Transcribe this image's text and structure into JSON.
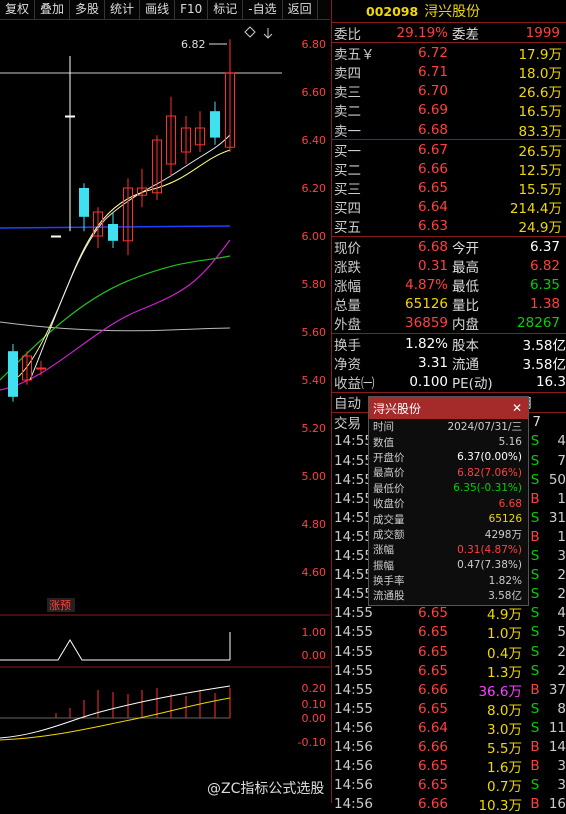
{
  "toolbar": [
    "复权",
    "叠加",
    "多股",
    "统计",
    "画线",
    "F10",
    "标记",
    "-自选",
    "返回"
  ],
  "stock": {
    "code": "002098",
    "name": "浔兴股份"
  },
  "chart": {
    "price_axis": [
      "6.80",
      "6.60",
      "6.40",
      "6.20",
      "6.00",
      "5.80",
      "5.60",
      "5.40",
      "5.20",
      "5.00",
      "4.80",
      "4.60"
    ],
    "high_marker": "6.82",
    "signal_label": "涨预",
    "ind1_axis": [
      "1.00",
      "0.00"
    ],
    "ind2_axis": [
      "0.20",
      "0.10",
      "0.00",
      "-0.10"
    ],
    "up_color": "#ff3030",
    "down_color": "#40e0f0"
  },
  "chart_data": {
    "type": "candlestick",
    "candles": [
      {
        "o": 5.33,
        "c": 5.52,
        "h": 5.55,
        "l": 5.31,
        "dir": "down"
      },
      {
        "o": 5.4,
        "c": 5.5,
        "h": 5.52,
        "l": 5.38,
        "dir": "up"
      },
      {
        "o": 5.45,
        "c": 5.45,
        "h": 5.48,
        "l": 5.42,
        "dir": "up"
      },
      {
        "o": 6.0,
        "c": 6.0,
        "h": 6.0,
        "l": 6.0,
        "dir": "flat"
      },
      {
        "o": 6.5,
        "c": 6.5,
        "h": 6.75,
        "l": 6.02,
        "dir": "flat"
      },
      {
        "o": 6.2,
        "c": 6.08,
        "h": 6.22,
        "l": 6.02,
        "dir": "down"
      },
      {
        "o": 6.0,
        "c": 6.1,
        "h": 6.12,
        "l": 5.95,
        "dir": "up"
      },
      {
        "o": 6.05,
        "c": 5.98,
        "h": 6.1,
        "l": 5.95,
        "dir": "down"
      },
      {
        "o": 5.98,
        "c": 6.2,
        "h": 6.24,
        "l": 5.92,
        "dir": "up"
      },
      {
        "o": 6.17,
        "c": 6.2,
        "h": 6.28,
        "l": 6.12,
        "dir": "up"
      },
      {
        "o": 6.18,
        "c": 6.4,
        "h": 6.42,
        "l": 6.15,
        "dir": "up"
      },
      {
        "o": 6.3,
        "c": 6.5,
        "h": 6.58,
        "l": 6.25,
        "dir": "up"
      },
      {
        "o": 6.35,
        "c": 6.45,
        "h": 6.5,
        "l": 6.3,
        "dir": "up"
      },
      {
        "o": 6.38,
        "c": 6.45,
        "h": 6.52,
        "l": 6.35,
        "dir": "up"
      },
      {
        "o": 6.52,
        "c": 6.41,
        "h": 6.56,
        "l": 6.38,
        "dir": "down"
      },
      {
        "o": 6.37,
        "c": 6.68,
        "h": 6.82,
        "l": 6.35,
        "dir": "up"
      }
    ]
  },
  "quote": {
    "weibi": {
      "label": "委比",
      "value": "29.19%",
      "label2": "委差",
      "value2": "1999"
    },
    "asks": [
      {
        "label": "卖五￥",
        "price": "6.72",
        "vol": "17.9万"
      },
      {
        "label": "卖四",
        "price": "6.71",
        "vol": "18.0万"
      },
      {
        "label": "卖三",
        "price": "6.70",
        "vol": "26.6万"
      },
      {
        "label": "卖二",
        "price": "6.69",
        "vol": "16.5万"
      },
      {
        "label": "卖一",
        "price": "6.68",
        "vol": "83.3万"
      }
    ],
    "bids": [
      {
        "label": "买一",
        "price": "6.67",
        "vol": "26.5万"
      },
      {
        "label": "买二",
        "price": "6.66",
        "vol": "12.5万"
      },
      {
        "label": "买三",
        "price": "6.65",
        "vol": "15.5万"
      },
      {
        "label": "买四",
        "price": "6.64",
        "vol": "214.4万"
      },
      {
        "label": "买五",
        "price": "6.63",
        "vol": "24.9万"
      }
    ],
    "stats": [
      {
        "l1": "现价",
        "v1": "6.68",
        "c1": "red",
        "l2": "今开",
        "v2": "6.37",
        "c2": "white"
      },
      {
        "l1": "涨跌",
        "v1": "0.31",
        "c1": "red",
        "l2": "最高",
        "v2": "6.82",
        "c2": "red"
      },
      {
        "l1": "涨幅",
        "v1": "4.87%",
        "c1": "red",
        "l2": "最低",
        "v2": "6.35",
        "c2": "green"
      },
      {
        "l1": "总量",
        "v1": "65126",
        "c1": "yellow",
        "l2": "量比",
        "v2": "1.38",
        "c2": "red"
      },
      {
        "l1": "外盘",
        "v1": "36859",
        "c1": "red",
        "l2": "内盘",
        "v2": "28267",
        "c2": "green"
      }
    ],
    "stats2": [
      {
        "l1": "换手",
        "v1": "1.82%",
        "l2": "股本",
        "v2": "3.58亿"
      },
      {
        "l1": "净资",
        "v1": "3.31",
        "l2": "流通",
        "v2": "3.58亿"
      },
      {
        "l1": "收益㈠",
        "v1": "0.100",
        "l2": "PE(动)",
        "v2": "16.3"
      }
    ],
    "auto_row": {
      "left": "自动",
      "right": "元/月"
    },
    "trade_row": {
      "left": "交易",
      "right": "7"
    }
  },
  "popup": {
    "title": "浔兴股份",
    "close": "✕",
    "rows": [
      {
        "k": "时间",
        "v": "2024/07/31/三",
        "c": "#ccc"
      },
      {
        "k": "数值",
        "v": "5.16",
        "c": "#ccc"
      },
      {
        "k": "开盘价",
        "v": "6.37(0.00%)",
        "c": "#ffffff"
      },
      {
        "k": "最高价",
        "v": "6.82(7.06%)",
        "c": "#ff4040"
      },
      {
        "k": "最低价",
        "v": "6.35(-0.31%)",
        "c": "#00d000"
      },
      {
        "k": "收盘价",
        "v": "6.68",
        "c": "#ff4040"
      },
      {
        "k": "成交量",
        "v": "65126",
        "c": "#f0d800"
      },
      {
        "k": "成交额",
        "v": "4298万",
        "c": "#ccc"
      },
      {
        "k": "涨幅",
        "v": "0.31(4.87%)",
        "c": "#ff4040"
      },
      {
        "k": "振幅",
        "v": "0.47(7.38%)",
        "c": "#ccc"
      },
      {
        "k": "换手率",
        "v": "1.82%",
        "c": "#ccc"
      },
      {
        "k": "流通股",
        "v": "3.58亿",
        "c": "#ccc"
      }
    ]
  },
  "trades": [
    {
      "t": "14:55",
      "p": "",
      "v": "",
      "d": "S",
      "c": "4"
    },
    {
      "t": "14:55",
      "p": "",
      "v": "",
      "d": "S",
      "c": "7"
    },
    {
      "t": "14:55",
      "p": "",
      "v": "",
      "d": "S",
      "c": "50"
    },
    {
      "t": "14:55",
      "p": "",
      "v": "",
      "d": "B",
      "c": "1"
    },
    {
      "t": "14:55",
      "p": "",
      "v": "",
      "d": "S",
      "c": "31"
    },
    {
      "t": "14:55",
      "p": "",
      "v": "",
      "d": "B",
      "c": "1"
    },
    {
      "t": "14:55",
      "p": "",
      "v": "",
      "d": "S",
      "c": "3"
    },
    {
      "t": "14:55",
      "p": "",
      "v": "",
      "d": "S",
      "c": "2"
    },
    {
      "t": "14:55",
      "p": "",
      "v": "",
      "d": "S",
      "c": "2"
    },
    {
      "t": "14:55",
      "p": "6.65",
      "v": "4.9万",
      "d": "S",
      "c": "4"
    },
    {
      "t": "14:55",
      "p": "6.65",
      "v": "1.0万",
      "d": "S",
      "c": "5"
    },
    {
      "t": "14:55",
      "p": "6.65",
      "v": "0.4万",
      "d": "S",
      "c": "2"
    },
    {
      "t": "14:55",
      "p": "6.65",
      "v": "1.3万",
      "d": "S",
      "c": "2"
    },
    {
      "t": "14:55",
      "p": "6.66",
      "v": "36.6万",
      "d": "B",
      "c": "37"
    },
    {
      "t": "14:55",
      "p": "6.65",
      "v": "8.0万",
      "d": "S",
      "c": "8"
    },
    {
      "t": "14:56",
      "p": "6.64",
      "v": "3.0万",
      "d": "S",
      "c": "11"
    },
    {
      "t": "14:56",
      "p": "6.66",
      "v": "5.5万",
      "d": "B",
      "c": "14"
    },
    {
      "t": "14:56",
      "p": "6.65",
      "v": "1.6万",
      "d": "B",
      "c": "3"
    },
    {
      "t": "14:56",
      "p": "6.65",
      "v": "0.7万",
      "d": "S",
      "c": "3"
    },
    {
      "t": "14:56",
      "p": "6.66",
      "v": "10.3万",
      "d": "B",
      "c": "16"
    }
  ],
  "watermark": "@ZC指标公式选股"
}
